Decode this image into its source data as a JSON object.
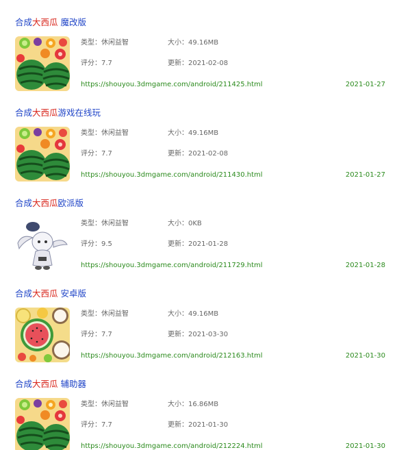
{
  "colors": {
    "title": "#1f44c7",
    "highlight": "#d8251b",
    "link": "#2a8a1c",
    "meta": "#666666"
  },
  "results": [
    {
      "title_prefix": "合成",
      "title_highlight": "大西瓜",
      "title_suffix": " 魔改版",
      "icon": "watermelon-fruit-icon",
      "type": "类型：休闲益智",
      "rating": "评分：7.7",
      "size": "大小：49.16MB",
      "updated": "更新：2021-02-08",
      "url": "https://shouyou.3dmgame.com/android/211425.html",
      "date": "2021-01-27"
    },
    {
      "title_prefix": "合成",
      "title_highlight": "大西瓜",
      "title_suffix": "游戏在线玩",
      "icon": "watermelon-fruit-icon",
      "type": "类型：休闲益智",
      "rating": "评分：7.7",
      "size": "大小：49.16MB",
      "updated": "更新：2021-02-08",
      "url": "https://shouyou.3dmgame.com/android/211430.html",
      "date": "2021-01-27"
    },
    {
      "title_prefix": "合成",
      "title_highlight": "大西瓜",
      "title_suffix": "欧派版",
      "icon": "bunny-character-icon",
      "type": "类型：休闲益智",
      "rating": "评分：9.5",
      "size": "大小：0KB",
      "updated": "更新：2021-01-28",
      "url": "https://shouyou.3dmgame.com/android/211729.html",
      "date": "2021-01-28"
    },
    {
      "title_prefix": "合成",
      "title_highlight": "大西瓜",
      "title_suffix": " 安卓版",
      "icon": "watermelon-slice-icon",
      "type": "类型：休闲益智",
      "rating": "评分：7.7",
      "size": "大小：49.16MB",
      "updated": "更新：2021-03-30",
      "url": "https://shouyou.3dmgame.com/android/212163.html",
      "date": "2021-01-30"
    },
    {
      "title_prefix": "合成",
      "title_highlight": "大西瓜",
      "title_suffix": " 辅助器",
      "icon": "watermelon-fruit-icon",
      "type": "类型：休闲益智",
      "rating": "评分：7.7",
      "size": "大小：16.86MB",
      "updated": "更新：2021-01-30",
      "url": "https://shouyou.3dmgame.com/android/212224.html",
      "date": "2021-01-30"
    }
  ]
}
